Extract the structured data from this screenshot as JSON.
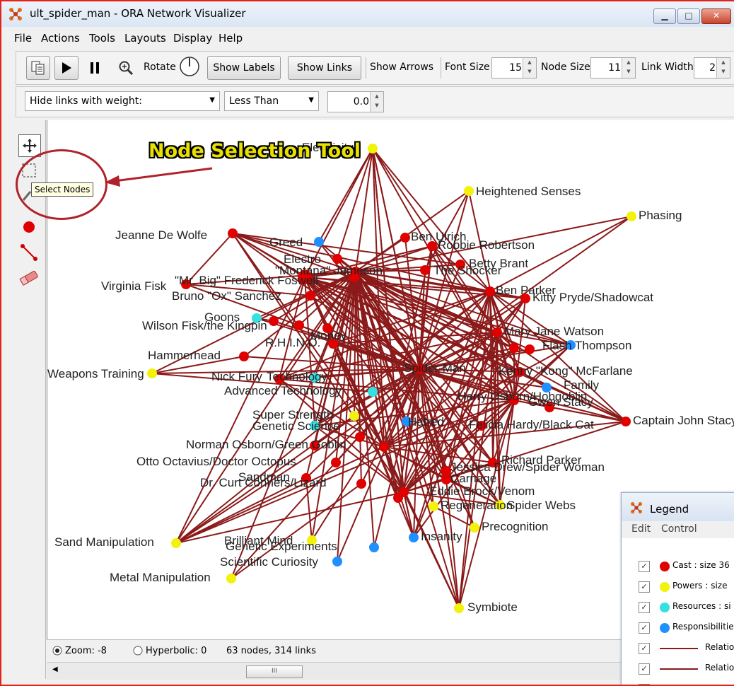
{
  "window": {
    "title": "ult_spider_man - ORA Network Visualizer",
    "minimize": "▁",
    "maximize": "□",
    "close": "✕"
  },
  "menu": [
    "File",
    "Actions",
    "Tools",
    "Layouts",
    "Display",
    "Help"
  ],
  "toolbar": {
    "rotate_label": "Rotate",
    "show_labels": "Show Labels",
    "show_links": "Show Links",
    "show_arrows": "Show Arrows",
    "font_size_label": "Font Size",
    "font_size_value": "15",
    "node_size_label": "Node Size",
    "node_size_value": "11",
    "link_width_label": "Link Width",
    "link_width_value": "2"
  },
  "filter": {
    "hide_links": "Hide links with weight:",
    "comparator": "Less Than",
    "threshold": "0.0"
  },
  "annotation": {
    "callout": "Node Selection Tool",
    "tooltip": "Select Nodes"
  },
  "status": {
    "zoom": "Zoom: -8",
    "hyperbolic": "Hyperbolic: 0",
    "counts": "63 nodes, 314 links",
    "scroll_thumb": "III"
  },
  "colors": {
    "cast": "#e00000",
    "powers": "#f2f20a",
    "resources": "#35e0e0",
    "responsibilities": "#1e90ff",
    "link": "#8b1a1a",
    "frame": "#e2231a"
  },
  "legend": {
    "title": "Legend",
    "menu": [
      "Edit",
      "Control"
    ],
    "rows": [
      {
        "text": "Cast : size 36",
        "kind": "cast"
      },
      {
        "text": "Powers : size",
        "kind": "powers"
      },
      {
        "text": "Resources : si",
        "kind": "resources"
      },
      {
        "text": "Responsibilitie",
        "kind": "responsibilities"
      },
      {
        "text": "Relatio",
        "kind": "link"
      },
      {
        "text": "Relatio",
        "kind": "link"
      },
      {
        "text": "Resou",
        "kind": "link"
      }
    ]
  },
  "network": {
    "labels": [
      "Electricity",
      "Heightened Senses",
      "Phasing",
      "Jeanne De Wolfe",
      "Greed",
      "Ben Ulrich",
      "Robbie Robertson",
      "Electro",
      "Betty Brant",
      "\"Montana\" Jameson",
      "The Shocker",
      "Virginia Fisk",
      "\"Mr. Big\" Frederick Foswell",
      "Bruno \"Ox\" Sanchez",
      "Ben Parker",
      "Kitty Pryde/Shadowcat",
      "Goons",
      "Wilson Fisk/the Kingpin",
      "Money",
      "R.H.I.N.O.",
      "Mary Jane Watson",
      "Flash Thompson",
      "Hammerhead",
      "Weapons Training",
      "Nick Fury",
      "Technology",
      "Spider-Man",
      "Kenny \"Kong\" McFarlane",
      "Family",
      "Advanced Technology",
      "Harry Osborn/Hobgoblin",
      "Gwen Stacy",
      "Super Strength",
      "Genetic Science",
      "Hatred",
      "Felicia Hardy/Black Cat",
      "Captain John Stacy",
      "Norman Osborn/Green Goblin",
      "Otto Octavius/Doctor Octopus",
      "Richard Parker",
      "Jessica Drew/Spider Woman",
      "Sandman",
      "Carnage",
      "Dr. Curt Conners/Lizard",
      "Eddie Brock/Venom",
      "Spider Webs",
      "Regeneration",
      "Precognition",
      "Sand Manipulation",
      "Brilliant Mind",
      "Genetic Experiments",
      "Insanity",
      "Scientific Curiosity",
      "Metal Manipulation",
      "Symbiote"
    ]
  }
}
